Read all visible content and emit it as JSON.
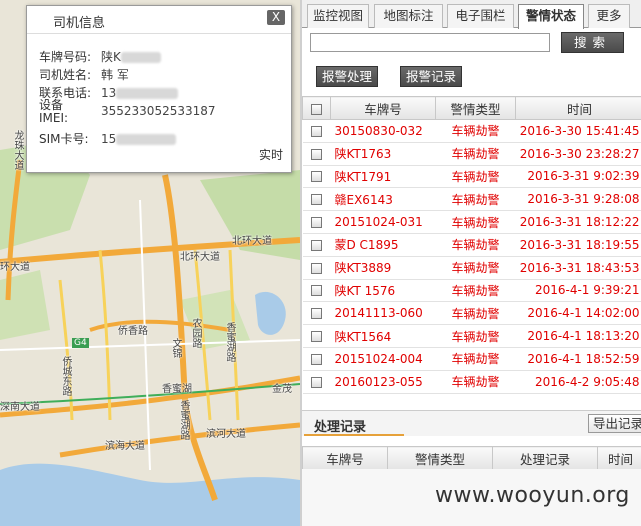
{
  "map": {
    "labels": [
      "北环大道",
      "北环大道",
      "环大道",
      "侨香路",
      "文锦",
      "农园路",
      "香蜜湖路",
      "侨城东路",
      "香蜜湖",
      "深南大道",
      "滨海大道",
      "滨河大道",
      "G4",
      "金茂",
      "龙珠大道",
      "香蜜湖路"
    ]
  },
  "driver_popup": {
    "title": "司机信息",
    "close_label": "X",
    "plate_label": "车牌号码:",
    "plate_value": "陕K",
    "name_label": "司机姓名:",
    "name_value": "韩 军",
    "phone_label": "联系电话:",
    "phone_value": "13",
    "imei_label_1": "设备",
    "imei_label_2": "IMEI:",
    "imei_value": "355233052533187",
    "sim_label": "SIM卡号:",
    "sim_value": "15",
    "realtime_label": "实时"
  },
  "tabs": [
    {
      "label": "监控视图",
      "active": false
    },
    {
      "label": "地图标注",
      "active": false
    },
    {
      "label": "电子围栏",
      "active": false
    },
    {
      "label": "警情状态",
      "active": true
    },
    {
      "label": "更多",
      "active": false
    }
  ],
  "search": {
    "value": "",
    "placeholder": "",
    "button_label": "搜索"
  },
  "actions": {
    "process_label": "报警处理",
    "record_label": "报警记录"
  },
  "alarm_table": {
    "headers": [
      "车牌号",
      "警情类型",
      "时间"
    ],
    "rows": [
      {
        "plate": "30150830-032",
        "type": "车辆劫警",
        "time": "2016-3-30 15:41:45"
      },
      {
        "plate": "陕KT1763",
        "type": "车辆劫警",
        "time": "2016-3-30 23:28:27"
      },
      {
        "plate": "陕KT1791",
        "type": "车辆劫警",
        "time": "2016-3-31 9:02:39"
      },
      {
        "plate": "赣EX6143",
        "type": "车辆劫警",
        "time": "2016-3-31 9:28:08"
      },
      {
        "plate": "20151024-031",
        "type": "车辆劫警",
        "time": "2016-3-31 18:12:22"
      },
      {
        "plate": "蒙D C1895",
        "type": "车辆劫警",
        "time": "2016-3-31 18:19:55"
      },
      {
        "plate": "陕KT3889",
        "type": "车辆劫警",
        "time": "2016-3-31 18:43:53"
      },
      {
        "plate": "陕KT 1576",
        "type": "车辆劫警",
        "time": "2016-4-1 9:39:21"
      },
      {
        "plate": "20141113-060",
        "type": "车辆劫警",
        "time": "2016-4-1 14:02:00"
      },
      {
        "plate": "陕KT1564",
        "type": "车辆劫警",
        "time": "2016-4-1 18:13:20"
      },
      {
        "plate": "20151024-004",
        "type": "车辆劫警",
        "time": "2016-4-1 18:52:59"
      },
      {
        "plate": "20160123-055",
        "type": "车辆劫警",
        "time": "2016-4-2 9:05:48"
      }
    ]
  },
  "process": {
    "title": "处理记录",
    "export_label": "导出记录",
    "headers": [
      "车牌号",
      "警情类型",
      "处理记录",
      "时间"
    ]
  },
  "watermark": "www.wooyun.org",
  "colors": {
    "alarm_text": "#e00000",
    "accent": "#e6a13a"
  }
}
